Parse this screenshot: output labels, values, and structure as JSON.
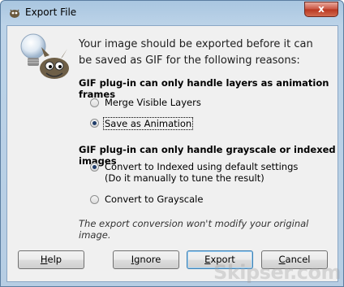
{
  "window": {
    "title": "Export File",
    "close_label": "x"
  },
  "header": {
    "line1": "Your image should be exported before it can",
    "line2": "be saved as GIF for the following reasons:"
  },
  "section1": {
    "title": "GIF plug-in can only handle layers as animation frames",
    "options": [
      {
        "label": "Merge Visible Layers",
        "checked": false
      },
      {
        "label": "Save as Animation",
        "checked": true
      }
    ]
  },
  "section2": {
    "title": "GIF plug-in can only handle grayscale or indexed images",
    "options": [
      {
        "label": "Convert to Indexed using default settings",
        "sub": "(Do it manually to tune the result)",
        "checked": true
      },
      {
        "label": "Convert to Grayscale",
        "checked": false
      }
    ]
  },
  "note": "The export conversion won't modify your original image.",
  "buttons": {
    "help": {
      "pre": "",
      "mn": "H",
      "post": "elp"
    },
    "ignore": {
      "pre": "",
      "mn": "I",
      "post": "gnore"
    },
    "export": {
      "pre": "",
      "mn": "E",
      "post": "xport"
    },
    "cancel": {
      "pre": "",
      "mn": "C",
      "post": "ancel"
    }
  },
  "watermark": "Skipser.com"
}
